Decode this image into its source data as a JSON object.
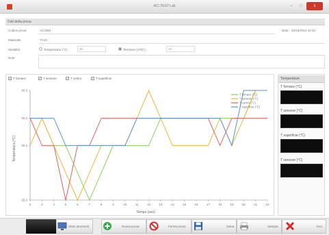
{
  "window": {
    "title": "ACI TEST Lab",
    "min_symbol": "–",
    "max_symbol": "□",
    "close_symbol": "x"
  },
  "section_title": "Dati della prova",
  "form": {
    "codice_label": "Codice prova",
    "codice_value": "AC1984",
    "data_label": "Data",
    "data_value": "20/10/2014 10:32",
    "materiale_label": "Materiale",
    "materiale_value": "TC20",
    "modalita_label": "Modalità",
    "radio1_label": "Temperatura (°C)",
    "radio1_value": "30",
    "radio2_label": "Tensione (V/SC)",
    "radio2_value": "10",
    "note_label": "Note"
  },
  "legend_checks": [
    {
      "label": "T fornace",
      "checked": true
    },
    {
      "label": "T sensore",
      "checked": true
    },
    {
      "label": "T centro",
      "checked": true
    },
    {
      "label": "T superficie",
      "checked": true
    }
  ],
  "side_panel": {
    "header": "Temperature",
    "fields": [
      {
        "label": "T fornace (°C)"
      },
      {
        "label": "T sensore (°C)"
      },
      {
        "label": "T superficie (°C)"
      },
      {
        "label": "T sensore (°C)"
      }
    ]
  },
  "toolbar": {
    "buttons": [
      {
        "label": "Stato strumenti",
        "icon": "monitor-icon"
      },
      {
        "label": "Nuova prova",
        "icon": "plus-circle-icon"
      },
      {
        "label": "Ferma prova",
        "icon": "stop-circle-icon"
      },
      {
        "label": "Salva",
        "icon": "save-icon"
      },
      {
        "label": "Stampa",
        "icon": "print-icon"
      },
      {
        "label": "Esci",
        "icon": "close-x-icon"
      }
    ]
  },
  "colors": {
    "series_green": "#8fcf5a",
    "series_yellow": "#e6b93a",
    "series_red": "#e4605e",
    "series_blue": "#5a8fd4",
    "close_button": "#cd3a2a",
    "display_bg": "#0c0c0c"
  },
  "chart_data": {
    "type": "line",
    "title": "",
    "xlabel": "Tempo (sec)",
    "ylabel": "Temperatura (°C)",
    "xlim": [
      2,
      22
    ],
    "ylim": [
      20.2,
      40.3
    ],
    "x_ticks": [
      2,
      3,
      4,
      5,
      6,
      7,
      8,
      9,
      10,
      11,
      12,
      13,
      14,
      15,
      16,
      17,
      18,
      19,
      20,
      21,
      22
    ],
    "x_tick_labels": [
      "2",
      "3",
      "4",
      "5",
      "6",
      "7",
      "8",
      "9",
      "10",
      "11",
      "12",
      "13",
      "14",
      "15",
      "16",
      "17",
      "18",
      "19",
      "20",
      "21",
      "22"
    ],
    "y_ticks": [
      20.2,
      30.2,
      35.2,
      40.3
    ],
    "y_tick_labels": [
      "20.2",
      "30.2",
      "35.2",
      "40.3"
    ],
    "legend_position": "top-right",
    "grid": false,
    "series": [
      {
        "name": "T fornace (°C)",
        "color": "#8fcf5a",
        "x": [
          2,
          3,
          4,
          5,
          6,
          7,
          8,
          9,
          10,
          11,
          12,
          13,
          14,
          15,
          16,
          17,
          18,
          19,
          20,
          21,
          22
        ],
        "y": [
          35.2,
          35.2,
          30.2,
          30.2,
          25.2,
          20.2,
          25.2,
          30.2,
          30.2,
          30.2,
          30.2,
          35.2,
          35.2,
          35.2,
          35.2,
          35.2,
          35.2,
          35.2,
          35.2,
          40.3,
          40.3
        ]
      },
      {
        "name": "T sensore (°C)",
        "color": "#e6b93a",
        "x": [
          2,
          3,
          4,
          5,
          6,
          7,
          8,
          9,
          10,
          11,
          12,
          13,
          14,
          15,
          16,
          17,
          18,
          19,
          20,
          21,
          22
        ],
        "y": [
          30.2,
          35.2,
          30.2,
          25.2,
          20.2,
          25.2,
          30.2,
          30.2,
          30.2,
          35.2,
          40.3,
          35.2,
          30.2,
          30.2,
          30.2,
          30.2,
          35.2,
          30.2,
          35.2,
          40.3,
          40.3
        ]
      },
      {
        "name": "T centro (°C)",
        "color": "#e4605e",
        "x": [
          2,
          3,
          4,
          5,
          6,
          7,
          8,
          9,
          10,
          11,
          12,
          13,
          14,
          15,
          16,
          17,
          18,
          19,
          20,
          21,
          22
        ],
        "y": [
          35.2,
          30.2,
          30.2,
          20.2,
          30.2,
          30.2,
          35.2,
          35.2,
          35.2,
          35.2,
          35.2,
          35.2,
          35.2,
          35.2,
          35.2,
          35.2,
          30.2,
          35.2,
          35.2,
          35.2,
          35.2
        ]
      },
      {
        "name": "T superficie (°C)",
        "color": "#5a8fd4",
        "x": [
          2,
          3,
          4,
          5,
          6,
          7,
          8,
          9,
          10,
          11,
          12,
          13,
          14,
          15,
          16,
          17,
          18,
          19,
          20,
          21,
          22
        ],
        "y": [
          35.2,
          35.2,
          35.2,
          30.2,
          30.2,
          30.2,
          30.2,
          30.2,
          30.2,
          35.2,
          35.2,
          35.2,
          35.2,
          35.2,
          35.2,
          35.2,
          35.2,
          30.2,
          40.3,
          40.3,
          40.3
        ]
      }
    ]
  }
}
